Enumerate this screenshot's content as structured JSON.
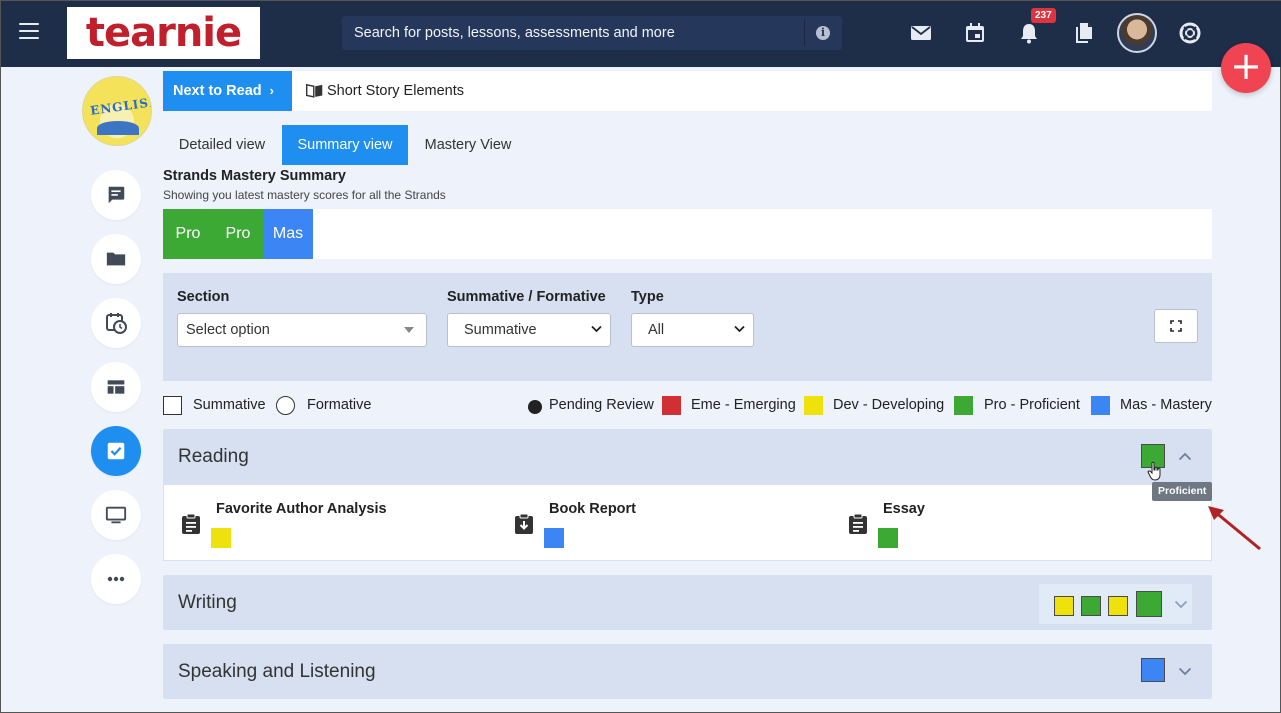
{
  "header": {
    "logo_text": "tearnie",
    "search_placeholder": "Search for posts, lessons, assessments and more",
    "notification_count": "237",
    "icons": [
      "hamburger-icon",
      "mail-icon",
      "calendar-icon",
      "bell-icon",
      "documents-icon",
      "avatar",
      "help-icon"
    ]
  },
  "fab_label": "+",
  "sidebar": {
    "course_logo_text": "ENGLISH",
    "items": [
      "chat-icon",
      "folder-icon",
      "calendar-clock-icon",
      "dashboard-icon",
      "checkbox-icon",
      "monitor-icon",
      "more-icon"
    ],
    "active_index": 4
  },
  "next_to_read": {
    "button_label": "Next to Read",
    "title": "Short Story Elements"
  },
  "tabs": [
    {
      "label": "Detailed view",
      "active": false
    },
    {
      "label": "Summary view",
      "active": true
    },
    {
      "label": "Mastery View",
      "active": false
    }
  ],
  "summary": {
    "title": "Strands Mastery Summary",
    "subtitle": "Showing you latest mastery scores for all the Strands",
    "chips": [
      {
        "label": "Pro",
        "color": "#3ca935"
      },
      {
        "label": "Pro",
        "color": "#3ca935"
      },
      {
        "label": "Mas",
        "color": "#3b86f4"
      }
    ]
  },
  "filters": {
    "section_label": "Section",
    "section_value": "Select option",
    "sf_label": "Summative / Formative",
    "sf_value": "Summative",
    "type_label": "Type",
    "type_value": "All"
  },
  "legend": {
    "summative": "Summative",
    "formative": "Formative",
    "pending": "Pending Review",
    "emerging": "Eme - Emerging",
    "developing": "Dev - Developing",
    "proficient": "Pro - Proficient",
    "mastery": "Mas - Mastery",
    "colors": {
      "emerging": "#d22f35",
      "developing": "#efe10b",
      "proficient": "#3ca935",
      "mastery": "#3b86f4"
    }
  },
  "strands": {
    "reading": {
      "name": "Reading",
      "overall": "#3ca935",
      "assignments": [
        {
          "title": "Favorite Author Analysis",
          "color": "#efe10b",
          "icon": "clipboard-icon"
        },
        {
          "title": "Book Report",
          "color": "#3b86f4",
          "icon": "clipboard-download-icon"
        },
        {
          "title": "Essay",
          "color": "#3ca935",
          "icon": "clipboard-icon"
        }
      ]
    },
    "writing": {
      "name": "Writing",
      "scores": [
        "#efe10b",
        "#3ca935",
        "#efe10b"
      ],
      "overall": "#3ca935"
    },
    "speaking": {
      "name": "Speaking and Listening",
      "overall": "#3b86f4"
    }
  },
  "tooltip": "Proficient"
}
